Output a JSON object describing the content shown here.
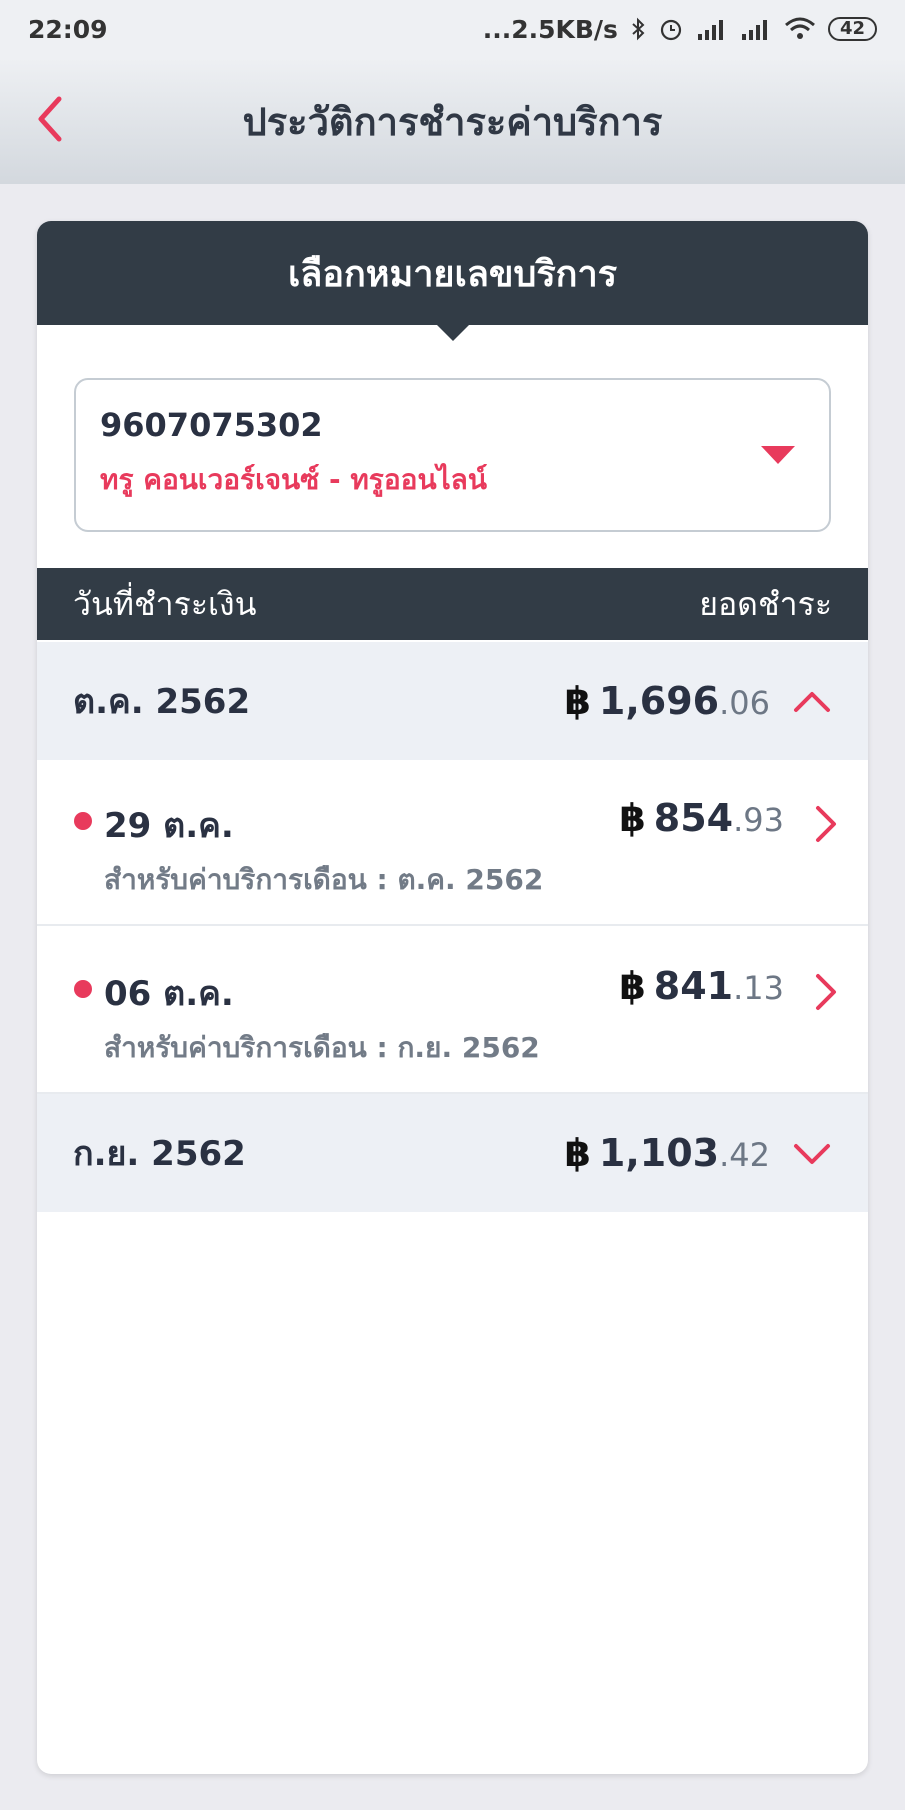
{
  "status_bar": {
    "time": "22:09",
    "network_speed": "...2.5KB/s",
    "battery": "42"
  },
  "header": {
    "title": "ประวัติการชำระค่าบริการ",
    "back_icon": "chevron-left-icon",
    "accent_color": "#e83a5c"
  },
  "card": {
    "heading": "เลือกหมายเลขบริการ",
    "selector": {
      "number": "9607075302",
      "provider": "ทรู คอนเวอร์เจนซ์ - ทรูออนไลน์"
    },
    "columns": {
      "date": "วันที่ชำระเงิน",
      "amount": "ยอดชำระ"
    },
    "currency_symbol": "฿",
    "groups": [
      {
        "label": "ต.ค. 2562",
        "amount_int": "1,696",
        "amount_dec": ".06",
        "expanded": true,
        "items": [
          {
            "date": "29 ต.ค.",
            "amount_int": "854",
            "amount_dec": ".93",
            "note": "สำหรับค่าบริการเดือน : ต.ค. 2562"
          },
          {
            "date": "06 ต.ค.",
            "amount_int": "841",
            "amount_dec": ".13",
            "note": "สำหรับค่าบริการเดือน : ก.ย. 2562"
          }
        ]
      },
      {
        "label": "ก.ย. 2562",
        "amount_int": "1,103",
        "amount_dec": ".42",
        "expanded": false
      }
    ]
  }
}
